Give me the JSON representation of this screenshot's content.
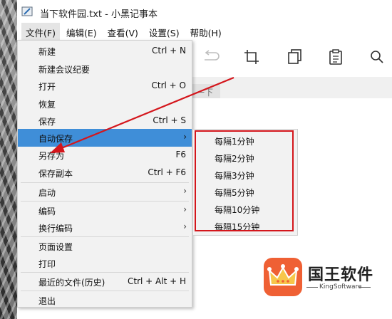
{
  "window": {
    "title": "当下软件园.txt - 小黑记事本"
  },
  "menubar": {
    "items": [
      "文件(F)",
      "编辑(E)",
      "查看(V)",
      "设置(S)",
      "帮助(H)"
    ]
  },
  "tab": {
    "label": "一下"
  },
  "file_menu": {
    "items": [
      {
        "label": "新建",
        "shortcut": "Ctrl + N"
      },
      {
        "label": "新建会议纪要",
        "shortcut": ""
      },
      {
        "label": "打开",
        "shortcut": "Ctrl + O"
      },
      {
        "label": "恢复",
        "shortcut": ""
      },
      {
        "label": "保存",
        "shortcut": "Ctrl + S"
      },
      {
        "label": "自动保存",
        "shortcut": "",
        "submenu": true,
        "highlighted": true
      },
      {
        "label": "另存为",
        "shortcut": "F6"
      },
      {
        "label": "保存副本",
        "shortcut": "Ctrl + F6"
      },
      {
        "label": "启动",
        "shortcut": "",
        "submenu": true
      },
      {
        "label": "编码",
        "shortcut": "",
        "submenu": true
      },
      {
        "label": "换行编码",
        "shortcut": "",
        "submenu": true
      },
      {
        "label": "页面设置",
        "shortcut": ""
      },
      {
        "label": "打印",
        "shortcut": ""
      },
      {
        "label": "最近的文件(历史)",
        "shortcut": "Ctrl + Alt + H"
      },
      {
        "label": "退出",
        "shortcut": ""
      }
    ]
  },
  "autosave_submenu": {
    "items": [
      "每隔1分钟",
      "每隔2分钟",
      "每隔3分钟",
      "每隔5分钟",
      "每隔10分钟",
      "每隔15分钟"
    ]
  },
  "toolbar": {
    "icons": [
      "redo-icon",
      "crop-icon",
      "copy-icon",
      "clipboard-icon",
      "search-icon"
    ]
  },
  "logo": {
    "name": "国王软件",
    "sub": "KingSoftware"
  },
  "colors": {
    "highlight": "#3f8ed8",
    "annotation_red": "#d4161c",
    "logo_orange": "#ef6034"
  }
}
